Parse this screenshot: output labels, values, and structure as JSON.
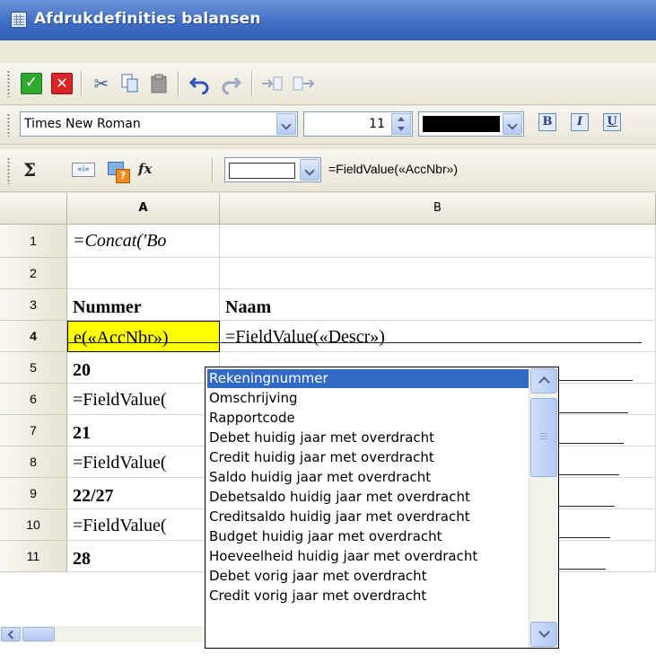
{
  "window": {
    "title": "Afdrukdefinities balansen"
  },
  "toolbar1": {
    "buttons": [
      "accept-icon",
      "cancel-icon",
      "cut-icon",
      "copy-icon",
      "paste-icon",
      "undo-icon",
      "redo-icon",
      "insert-row-icon",
      "insert-column-icon"
    ]
  },
  "toolbar2": {
    "font_name": "Times New Roman",
    "font_size": "11",
    "font_color": "#000000",
    "bold_label": "B",
    "italic_label": "I",
    "underline_label": "U"
  },
  "toolbar3": {
    "sigma": "Σ",
    "field_icon": "«i»",
    "fx": "fx",
    "formula": "=FieldValue(«AccNbr»)"
  },
  "grid": {
    "columns": [
      "A",
      "B"
    ],
    "rows": [
      {
        "num": "1",
        "a": "=Concat('Bo",
        "b": ""
      },
      {
        "num": "2",
        "a": "",
        "b": ""
      },
      {
        "num": "3",
        "a": "Nummer",
        "b": "Naam"
      },
      {
        "num": "4",
        "a": "e(«AccNbr»)",
        "b": "=FieldValue(«Descr»)"
      },
      {
        "num": "5",
        "a": "20",
        "b": ""
      },
      {
        "num": "6",
        "a": "=FieldValue(",
        "b": ""
      },
      {
        "num": "7",
        "a": "21",
        "b": ""
      },
      {
        "num": "8",
        "a": "=FieldValue(",
        "b": ""
      },
      {
        "num": "9",
        "a": "22/27",
        "b": ""
      },
      {
        "num": "10",
        "a": "=FieldValue(",
        "b": ""
      },
      {
        "num": "11",
        "a": "28",
        "b": ""
      }
    ]
  },
  "dropdown": {
    "selected": "Rekeningnummer",
    "items": [
      "Rekeningnummer",
      "Omschrijving",
      "Rapportcode",
      "Debet huidig jaar met overdracht",
      "Credit huidig jaar met overdracht",
      "Saldo huidig jaar met overdracht",
      "Debetsaldo huidig jaar met overdracht",
      "Creditsaldo huidig jaar met overdracht",
      "Budget huidig jaar met overdracht",
      "Hoeveelheid huidig jaar met overdracht",
      "Debet vorig jaar met overdracht",
      "Credit vorig jaar met overdracht"
    ]
  },
  "colors": {
    "title_bar": "#3f6ec4",
    "selection": "#316ac5",
    "active_cell": "#ffff00"
  }
}
